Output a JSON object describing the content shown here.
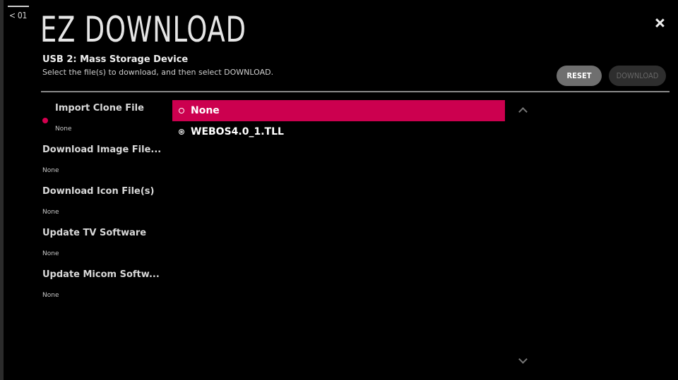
{
  "header": {
    "back_label": "< 01",
    "title": "EZ DOWNLOAD",
    "device": "USB 2: Mass Storage Device",
    "instruction": "Select the file(s) to download, and then select DOWNLOAD."
  },
  "buttons": {
    "reset_label": "RESET",
    "download_label": "DOWNLOAD"
  },
  "menu": {
    "items": [
      {
        "label": "Import Clone File",
        "value": "None",
        "active": true
      },
      {
        "label": "Download Image File...",
        "value": "None"
      },
      {
        "label": "Download Icon File(s)",
        "value": "None"
      },
      {
        "label": "Update TV Software",
        "value": "None"
      },
      {
        "label": "Update Micom Softw...",
        "value": "None"
      }
    ]
  },
  "file_list": {
    "items": [
      {
        "label": "None",
        "selected": true
      },
      {
        "label": "WEBOS4.0_1.TLL",
        "selected": false
      }
    ]
  },
  "colors": {
    "accent": "#cc004f",
    "active_dot": "#d4004f",
    "background": "#000000",
    "reset_button": "#6f6f6f",
    "download_button_disabled": "#2e2e2e"
  },
  "icons": {
    "close": "close-icon",
    "scroll_up": "chevron-up-icon",
    "scroll_down": "chevron-down-icon"
  }
}
